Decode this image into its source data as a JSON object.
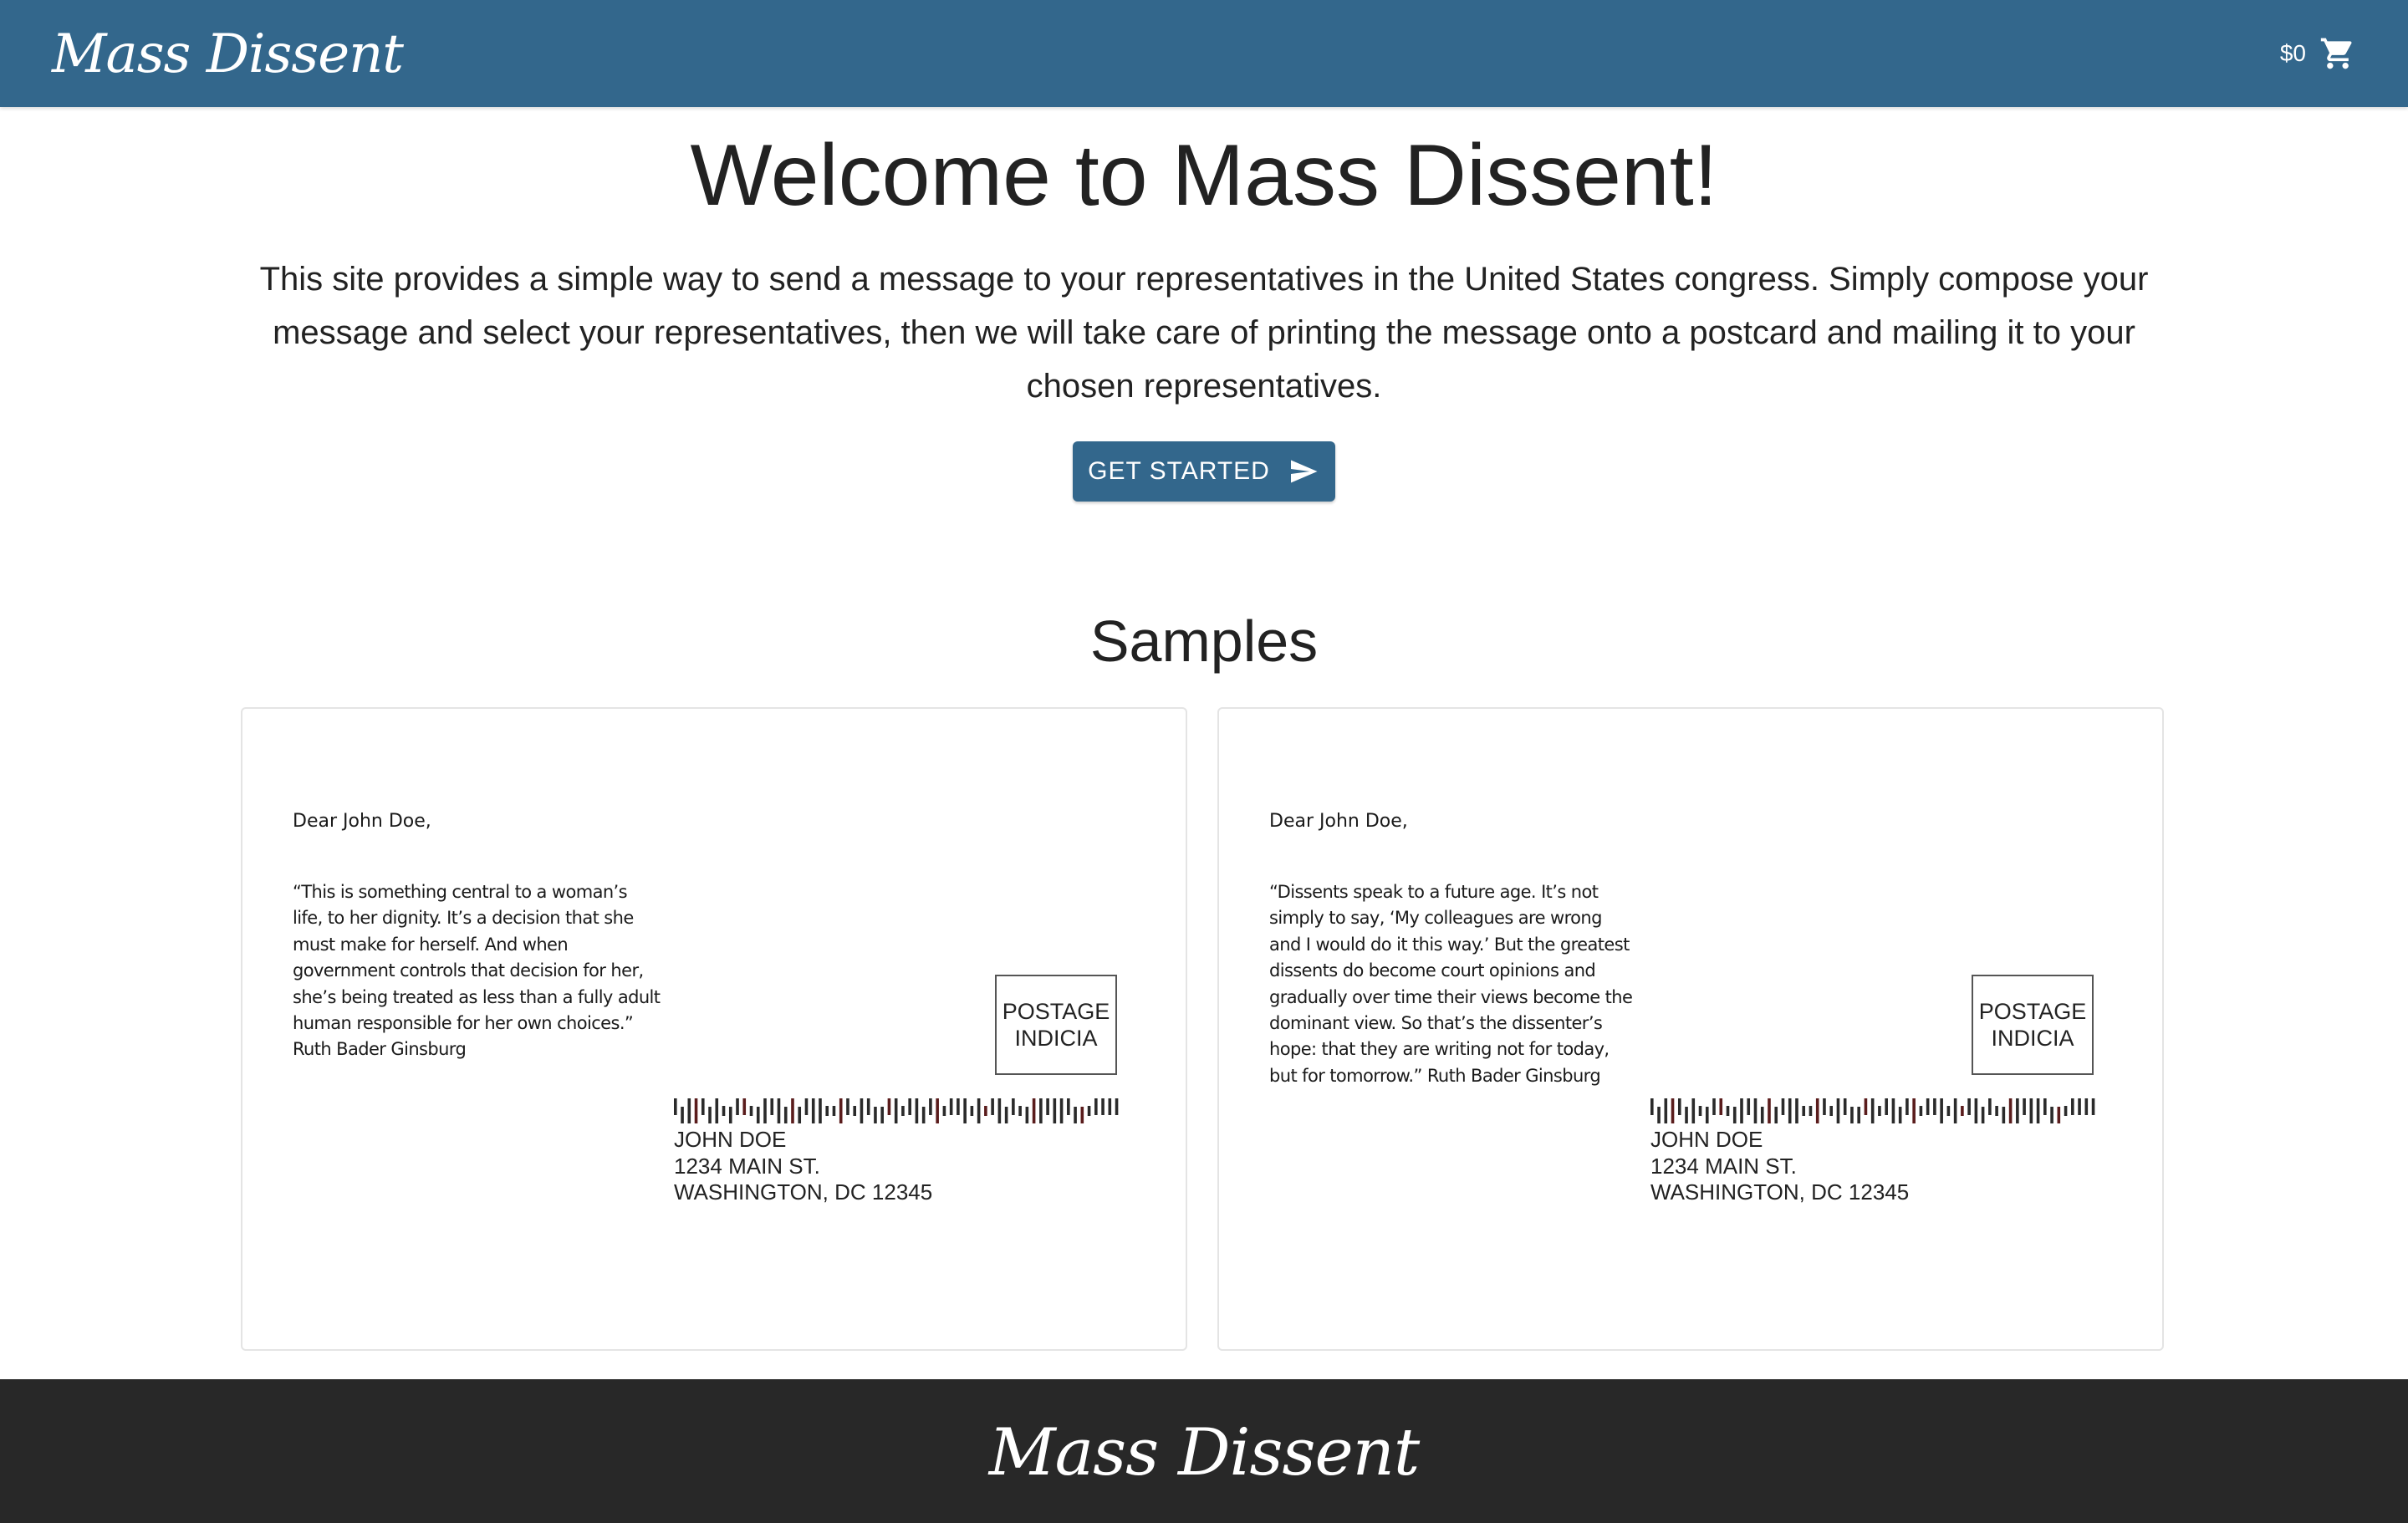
{
  "header": {
    "brand": "Mass Dissent",
    "cart_total": "$0",
    "cart_icon": "shopping-cart-icon",
    "background_color": "#33678c"
  },
  "hero": {
    "title": "Welcome to Mass Dissent!",
    "description": "This site provides a simple way to send a message to your representatives in the United States congress. Simply compose your message and select your representatives, then we will take care of printing the message onto a postcard and mailing it to your chosen representatives.",
    "cta_label": "GET STARTED",
    "cta_icon": "send-icon"
  },
  "samples": {
    "title": "Samples",
    "cards": [
      {
        "greeting": "Dear John Doe,",
        "message": "“This is something central to a woman’s life, to her dignity. It’s a decision that she must make for herself. And when government controls that decision for her, she’s being treated as less than a fully adult human responsible for her own choices.”  Ruth Bader Ginsburg",
        "postage_line1": "POSTAGE",
        "postage_line2": "INDICIA",
        "address_name": "JOHN DOE",
        "address_street": "1234 MAIN ST.",
        "address_city": "WASHINGTON, DC 12345"
      },
      {
        "greeting": "Dear John Doe,",
        "message": "“Dissents speak to a future age. It’s not simply to say, ‘My colleagues are wrong and I would do it this way.’ But the greatest dissents do become court opinions and gradually over time their views become the dominant view. So that’s the dissenter’s hope: that they are writing not for today, but for tomorrow.” Ruth Bader Ginsburg",
        "postage_line1": "POSTAGE",
        "postage_line2": "INDICIA",
        "address_name": "JOHN DOE",
        "address_street": "1234 MAIN ST.",
        "address_city": "WASHINGTON, DC 12345"
      }
    ]
  },
  "footer": {
    "brand": "Mass Dissent",
    "background_color": "#282828"
  }
}
